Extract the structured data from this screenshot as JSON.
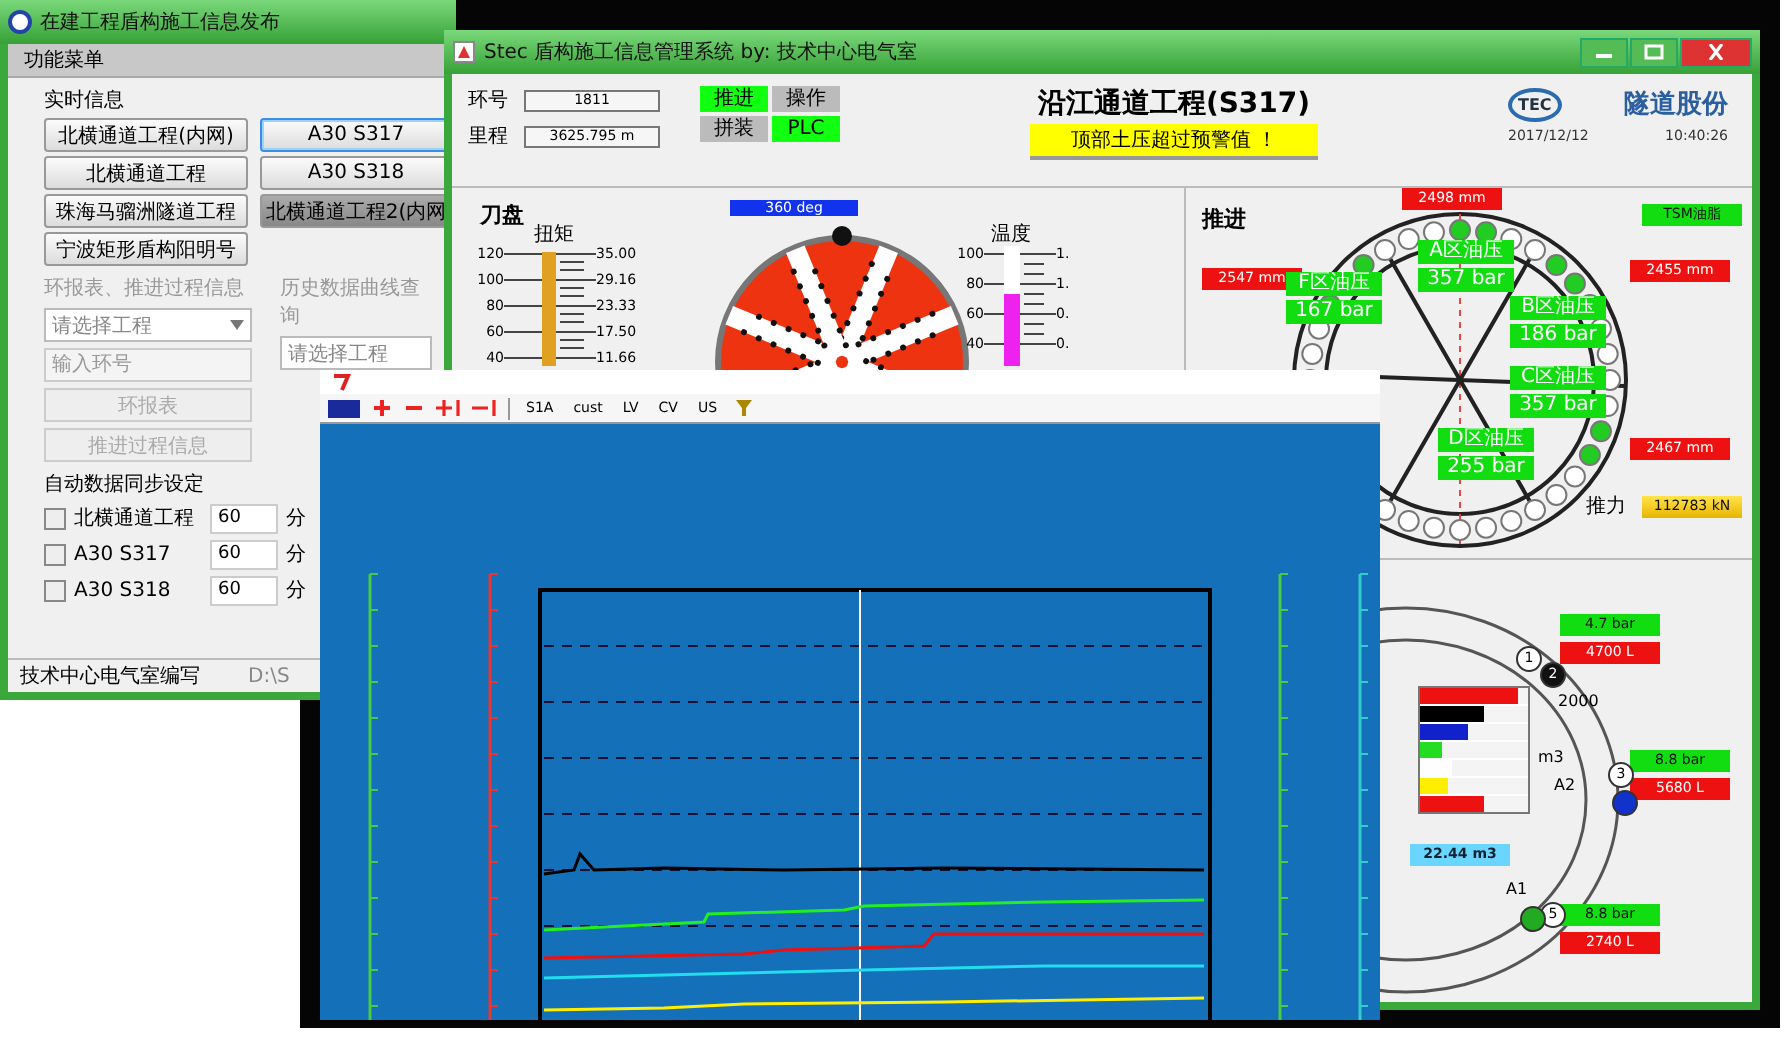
{
  "left_window": {
    "title": "在建工程盾构施工信息发布",
    "menu": "功能菜单",
    "realtime": {
      "heading": "实时信息",
      "projects": [
        {
          "label": "北横通道工程(内网)",
          "selected": false,
          "pressed": false
        },
        {
          "label": "A30 S317",
          "selected": true,
          "pressed": false
        },
        {
          "label": "北横通道工程",
          "selected": false,
          "pressed": false
        },
        {
          "label": "A30 S318",
          "selected": false,
          "pressed": false
        },
        {
          "label": "珠海马骝洲隧道工程",
          "selected": false,
          "pressed": false
        },
        {
          "label": "北横通道工程2(内网",
          "selected": false,
          "pressed": true
        },
        {
          "label": "宁波矩形盾构阳明号",
          "selected": false,
          "pressed": false
        }
      ]
    },
    "report": {
      "heading": "环报表、推进过程信息",
      "select": "请选择工程",
      "ring_field": {
        "placeholder": "输入环号"
      },
      "buttons": [
        {
          "label": "环报表",
          "disabled": true
        },
        {
          "label": "推进过程信息",
          "disabled": true
        }
      ]
    },
    "history": {
      "heading": "历史数据曲线查询",
      "select": "请选择工程"
    },
    "auto_sync": {
      "heading": "自动数据同步设定",
      "rows": [
        {
          "label": "北横通道工程",
          "checked": false,
          "value": "60",
          "unit": "分"
        },
        {
          "label": "A30 S317",
          "checked": false,
          "value": "60",
          "unit": "分"
        },
        {
          "label": "A30 S318",
          "checked": false,
          "value": "60",
          "unit": "分"
        }
      ]
    },
    "status_bar": {
      "left": "技术中心电气室编写",
      "right": "D:\\S"
    }
  },
  "monitor_window": {
    "title": "Stec 盾构施工信息管理系统  by: 技术中心电气室",
    "ring_no": {
      "label": "环号",
      "value": "1811"
    },
    "mileage": {
      "label": "里程",
      "value": "3625.795 m"
    },
    "status_lights": [
      {
        "label": "推进",
        "on": true
      },
      {
        "label": "操作",
        "on": false
      },
      {
        "label": "拼装",
        "on": false
      },
      {
        "label": "PLC",
        "on": true
      }
    ],
    "project_title": "沿江通道工程(S317)",
    "alarm": "顶部土压超过预警值 ！",
    "logo_mark": "TEC",
    "company": "隧道股份",
    "date": "2017/12/12",
    "time": "10:40:26",
    "cutterhead": {
      "heading": "刀盘",
      "angle": "360 deg",
      "torque": {
        "label": "扭矩",
        "level": 0.95,
        "left_ticks": [
          "120",
          "100",
          "80",
          "60",
          "40"
        ],
        "right_ticks": [
          "35.00",
          "29.16",
          "23.33",
          "17.50",
          "11.66"
        ]
      },
      "temperature": {
        "label": "温度",
        "level": 0.6,
        "left_ticks": [
          "100",
          "80",
          "60",
          "40"
        ],
        "right_ticks": [
          "1.",
          "1.",
          "0.",
          "0."
        ]
      }
    },
    "thrust": {
      "heading": "推进",
      "grease": "TSM油脂",
      "strokes": [
        "2498 mm",
        "2547 mm",
        "2455 mm",
        "2467 mm"
      ],
      "zones": [
        {
          "name": "A区油压",
          "pressure": "357 bar"
        },
        {
          "name": "B区油压",
          "pressure": "186 bar"
        },
        {
          "name": "C区油压",
          "pressure": "357 bar"
        },
        {
          "name": "D区油压",
          "pressure": "255 bar"
        },
        {
          "name": "F区油压",
          "pressure": "167 bar"
        }
      ],
      "cylinders_active": [
        true,
        true,
        false,
        false,
        true,
        true,
        false,
        false,
        false,
        false,
        false,
        true,
        true,
        false,
        false,
        false,
        false,
        false,
        false,
        false,
        false,
        false,
        false,
        false,
        false,
        false,
        false,
        false,
        false,
        false,
        true,
        false,
        true,
        false,
        false,
        false
      ],
      "force_label": "推力",
      "force": "112783 kN"
    },
    "grout": {
      "scale_max": "2000",
      "unit": "m3",
      "total": "22.44 m3",
      "ports": [
        {
          "pressure": "4.7 bar",
          "volume": "4700 L"
        },
        {
          "pressure": "8.8 bar",
          "volume": "5680 L"
        },
        {
          "pressure": "8.8 bar",
          "volume": "2740 L"
        }
      ],
      "tanks": [
        {
          "level": 0.9,
          "color": "#ee1111"
        },
        {
          "level": 0.6,
          "color": "#000000"
        },
        {
          "level": 0.45,
          "color": "#1122cc"
        },
        {
          "level": 0.2,
          "color": "#22dd22"
        },
        {
          "level": 0.3,
          "color": "#ffffff"
        },
        {
          "level": 0.25,
          "color": "#ffee00"
        },
        {
          "level": 0.6,
          "color": "#ee1111"
        }
      ],
      "markers": [
        {
          "label": "1",
          "color": "#ffffff"
        },
        {
          "label": "2",
          "color": "#111111"
        },
        {
          "label": "3",
          "color": "#ffffff"
        },
        {
          "color": "#1133cc"
        },
        {
          "label": "5",
          "color": "#ffffff"
        },
        {
          "color": "#22aa22"
        }
      ],
      "port_names": [
        "A2",
        "A1"
      ]
    }
  },
  "chart_window": {
    "toolbar": [
      "S1A",
      "cust",
      "LV",
      "CV",
      "US"
    ]
  }
}
